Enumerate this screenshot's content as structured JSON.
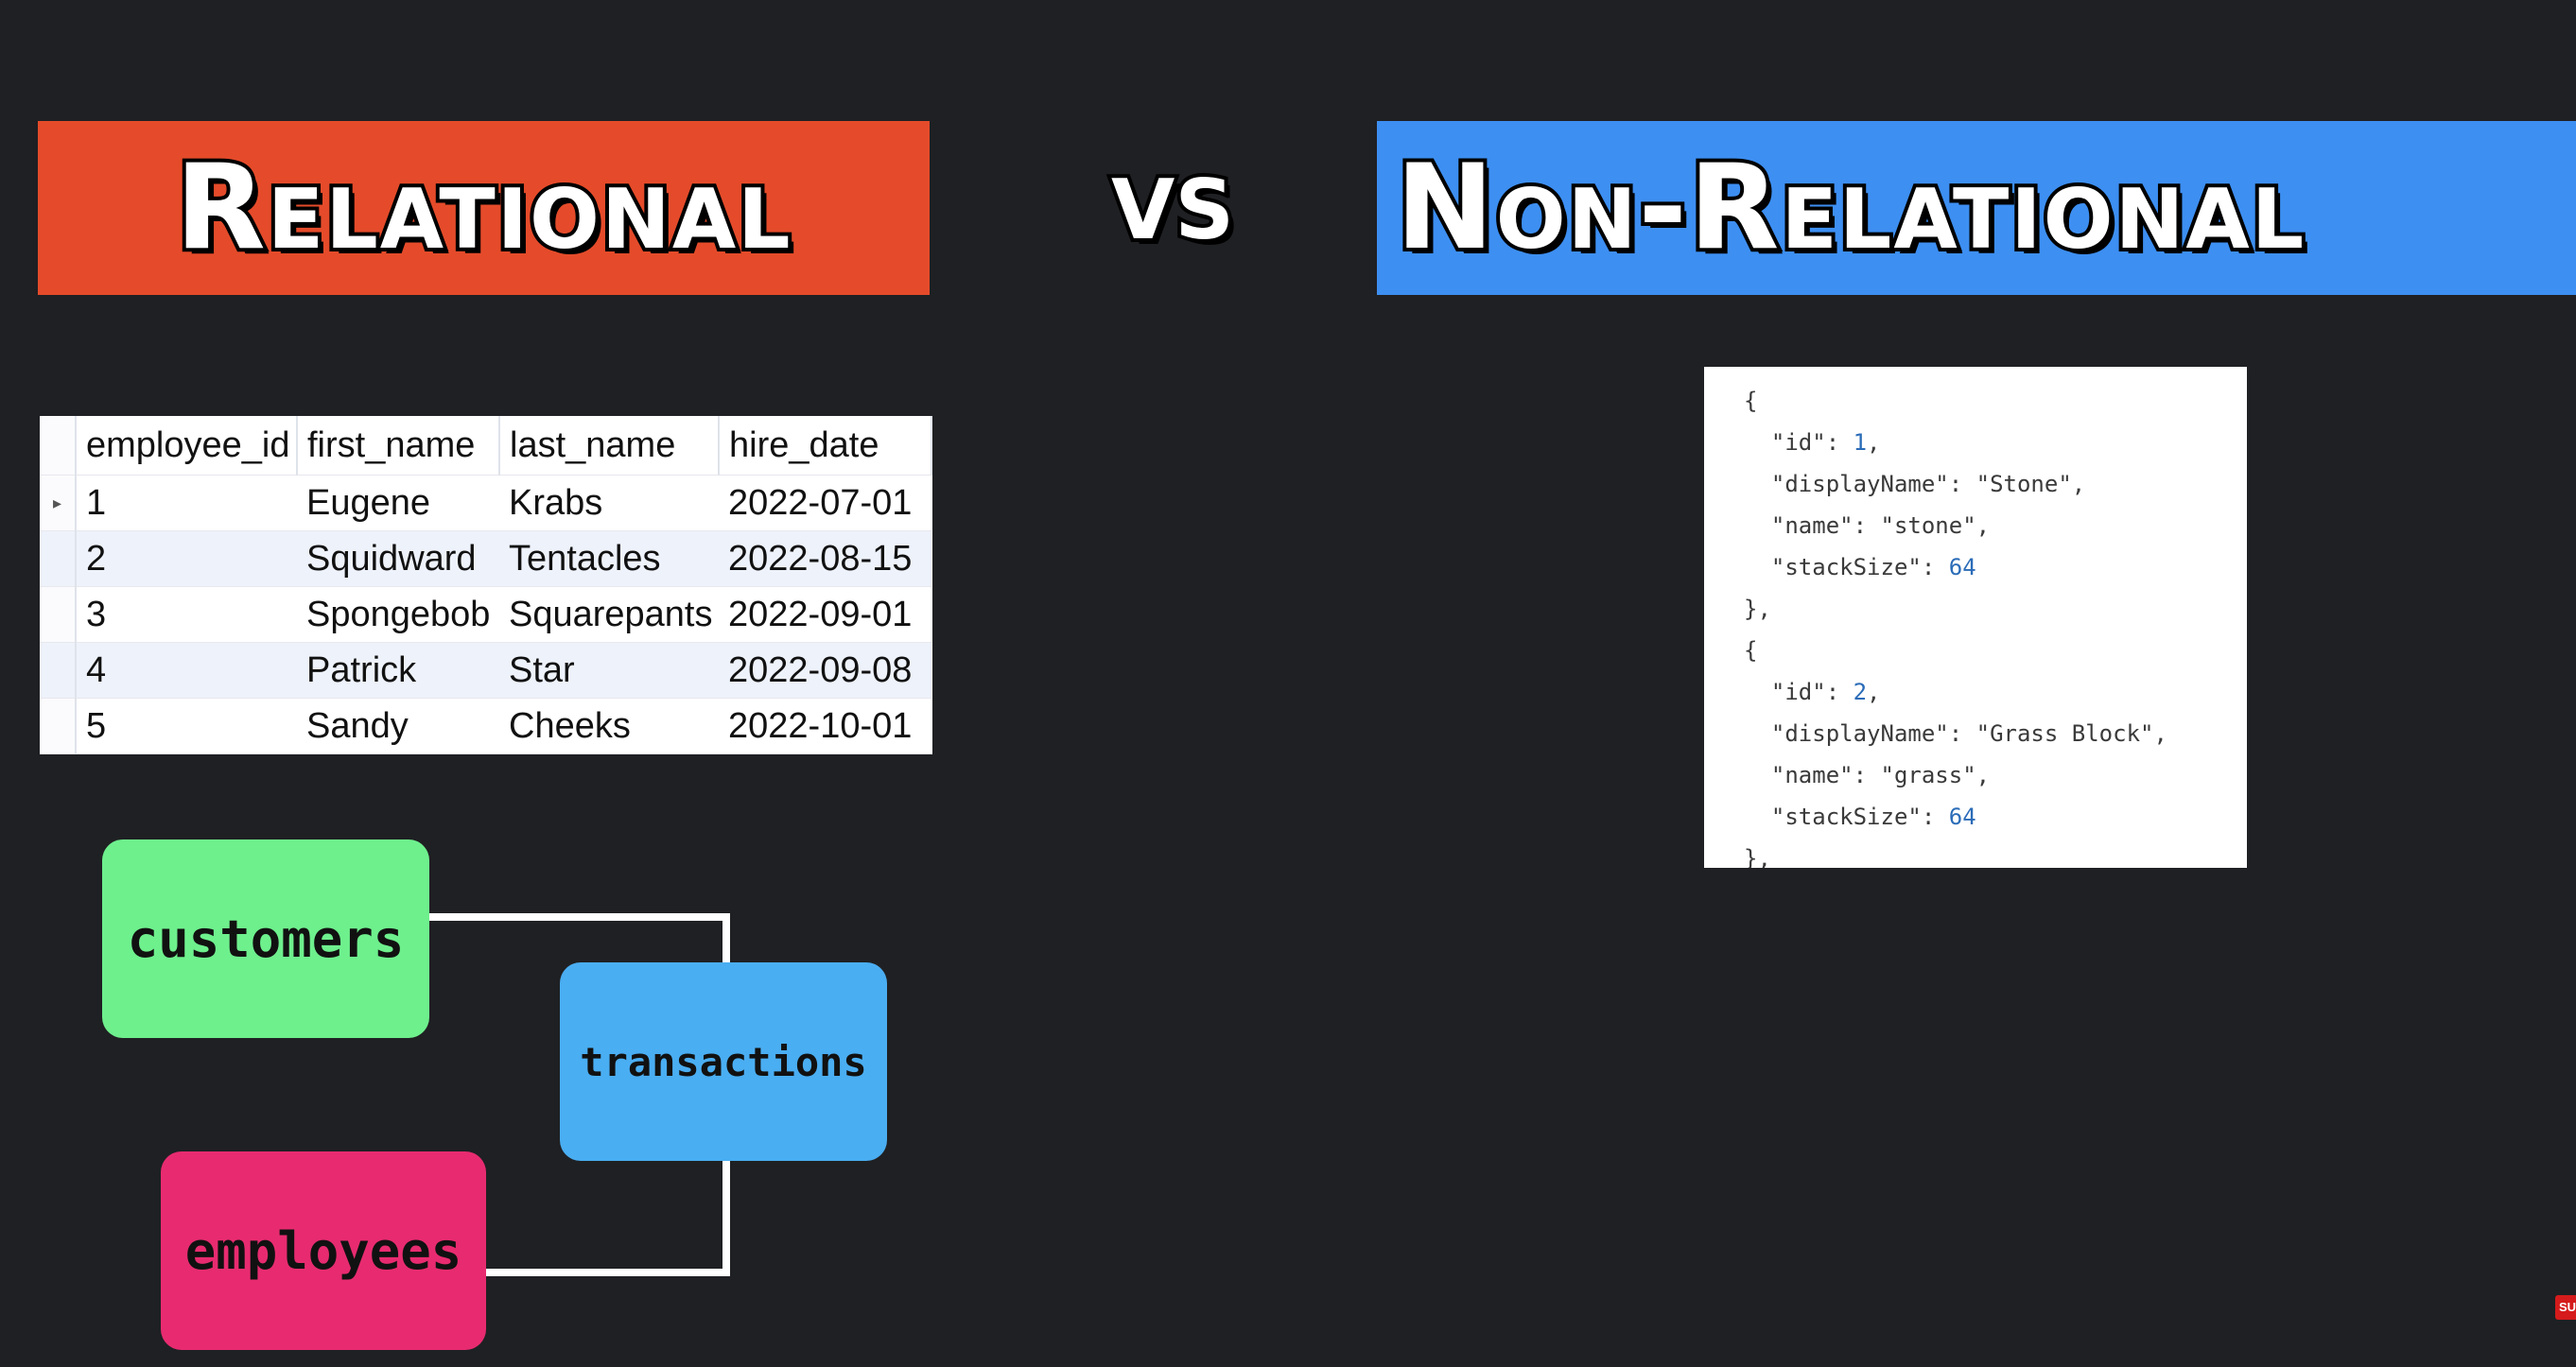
{
  "banners": {
    "relational": "Relational",
    "vs": "vs",
    "non_relational": "Non-Relational"
  },
  "colors": {
    "background": "#1f2023",
    "relational_banner": "#e54b2a",
    "non_relational_banner": "#3d8ff2",
    "customers_box": "#6ef08d",
    "transactions_box": "#4aaef2",
    "employees_box": "#e82b70"
  },
  "table": {
    "columns": [
      "employee_id",
      "first_name",
      "last_name",
      "hire_date"
    ],
    "current_row_marker": "▸",
    "rows": [
      [
        "1",
        "Eugene",
        "Krabs",
        "2022-07-01"
      ],
      [
        "2",
        "Squidward",
        "Tentacles",
        "2022-08-15"
      ],
      [
        "3",
        "Spongebob",
        "Squarepants",
        "2022-09-01"
      ],
      [
        "4",
        "Patrick",
        "Star",
        "2022-09-08"
      ],
      [
        "5",
        "Sandy",
        "Cheeks",
        "2022-10-01"
      ]
    ]
  },
  "diagram": {
    "customers": "customers",
    "transactions": "transactions",
    "employees": "employees"
  },
  "json_doc": {
    "lines": [
      {
        "text": "{"
      },
      {
        "text": "  \"id\": ",
        "num": "1",
        "after": ","
      },
      {
        "text": "  \"displayName\": \"Stone\","
      },
      {
        "text": "  \"name\": \"stone\","
      },
      {
        "text": "  \"stackSize\": ",
        "num": "64"
      },
      {
        "text": "},"
      },
      {
        "text": "{"
      },
      {
        "text": "  \"id\": ",
        "num": "2",
        "after": ","
      },
      {
        "text": "  \"displayName\": \"Grass Block\","
      },
      {
        "text": "  \"name\": \"grass\","
      },
      {
        "text": "  \"stackSize\": ",
        "num": "64"
      },
      {
        "text": "},"
      }
    ]
  },
  "corner_badge": "SU",
  "icons": {
    "row_selector": "caret-right-icon"
  }
}
